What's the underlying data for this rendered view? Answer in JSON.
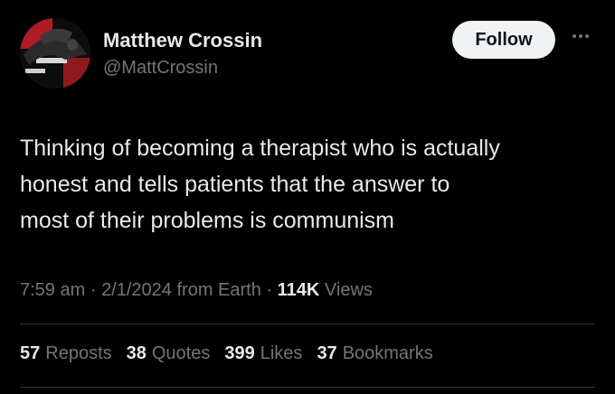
{
  "author": {
    "name": "Matthew Crossin",
    "handle": "@MattCrossin"
  },
  "actions": {
    "follow_label": "Follow",
    "more_icon": "more-dots-icon"
  },
  "tweet": {
    "text": "Thinking of becoming a therapist who is actually\nhonest and tells patients that the answer to\nmost of their problems is communism"
  },
  "meta": {
    "time": "7:59 am",
    "sep1": "·",
    "date": "2/1/2024",
    "source": "from Earth",
    "sep2": "·",
    "views_count": "114K",
    "views_label": "Views"
  },
  "stats": {
    "reposts": {
      "count": "57",
      "label": "Reposts"
    },
    "quotes": {
      "count": "38",
      "label": "Quotes"
    },
    "likes": {
      "count": "399",
      "label": "Likes"
    },
    "bookmarks": {
      "count": "37",
      "label": "Bookmarks"
    }
  },
  "colors": {
    "background": "#000000",
    "text": "#e7e9ea",
    "muted": "#71767b",
    "button": "#eff3f4"
  }
}
